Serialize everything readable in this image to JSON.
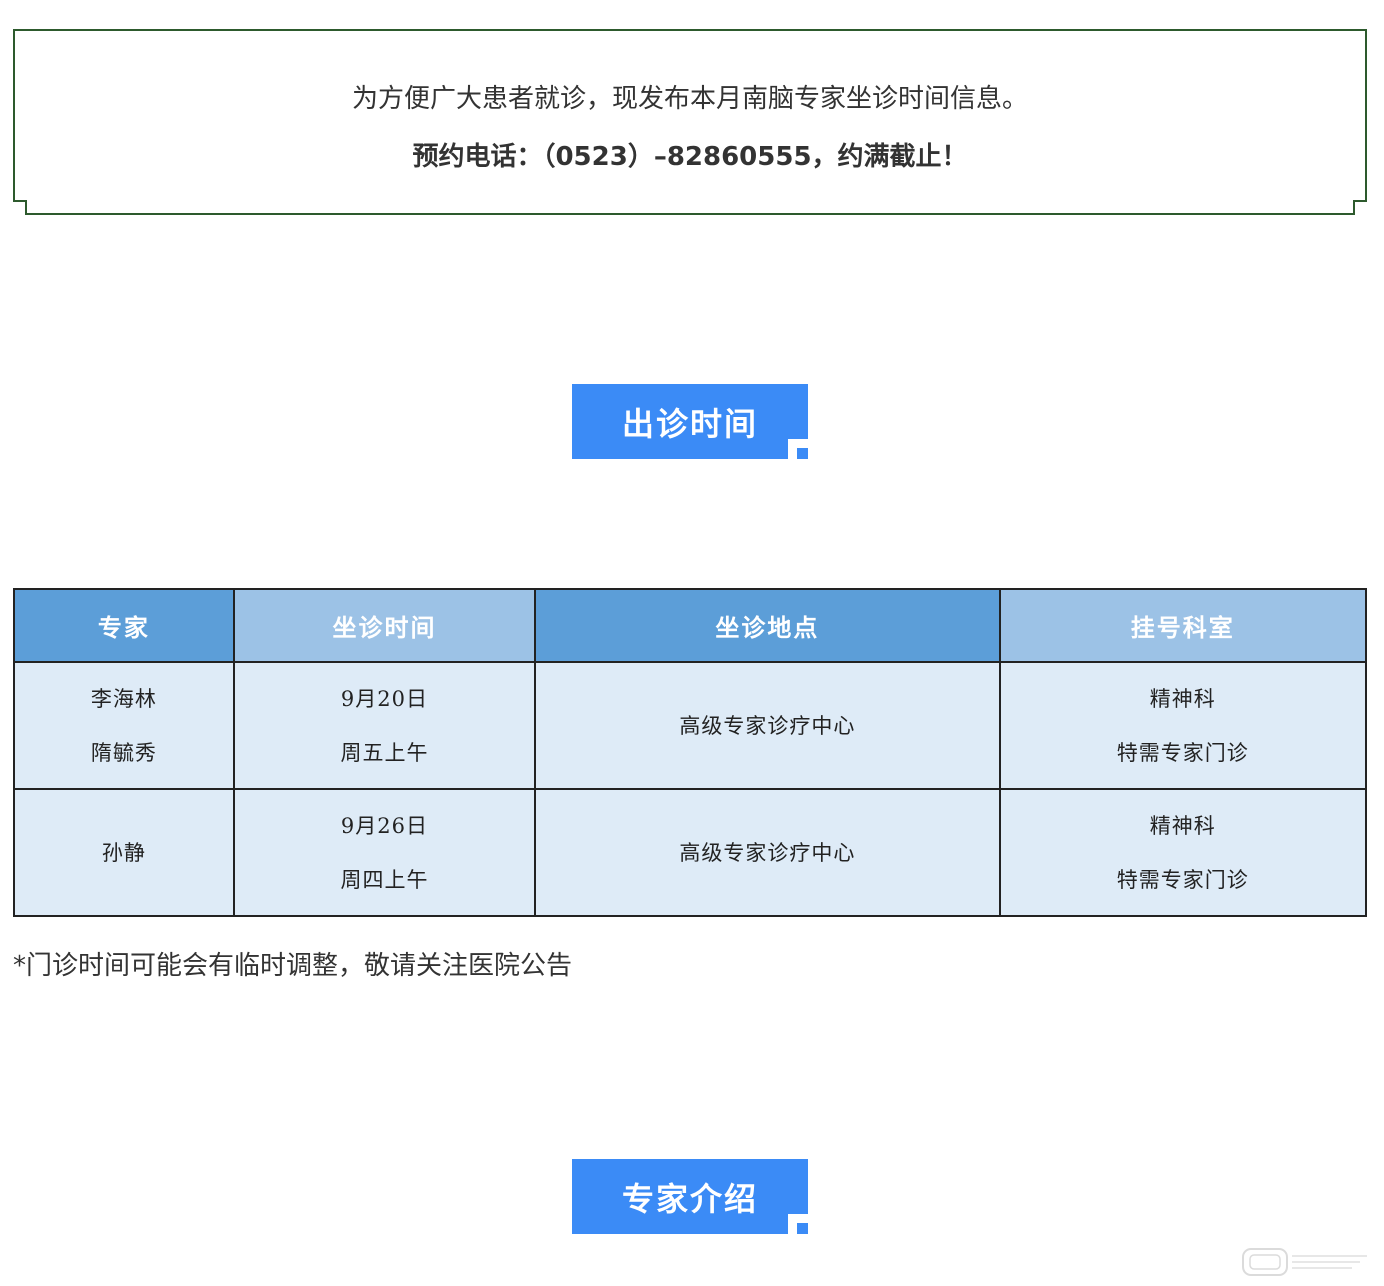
{
  "colors": {
    "notice_border": "#2d5a2d",
    "header_blue": "#3b8bf6",
    "table_header_dark": "#5c9ed8",
    "table_header_light": "#9cc2e6",
    "table_cell_bg": "#deebf7"
  },
  "notice": {
    "line1": "为方便广大患者就诊，现发布本月南脑专家坐诊时间信息。",
    "line2": "预约电话：（0523）–82860555，约满截止！"
  },
  "section_schedule": {
    "title": "出诊时间"
  },
  "table": {
    "headers": [
      "专家",
      "坐诊时间",
      "坐诊地点",
      "挂号科室"
    ],
    "rows": [
      {
        "experts": [
          "李海林",
          "隋毓秀"
        ],
        "time": [
          "9月20日",
          "周五上午"
        ],
        "location": "高级专家诊疗中心",
        "department": [
          "精神科",
          "特需专家门诊"
        ]
      },
      {
        "experts": [
          "孙静"
        ],
        "time": [
          "9月26日",
          "周四上午"
        ],
        "location": "高级专家诊疗中心",
        "department": [
          "精神科",
          "特需专家门诊"
        ]
      }
    ]
  },
  "footnote": "*门诊时间可能会有临时调整，敬请关注医院公告",
  "section_experts": {
    "title": "专家介绍"
  }
}
